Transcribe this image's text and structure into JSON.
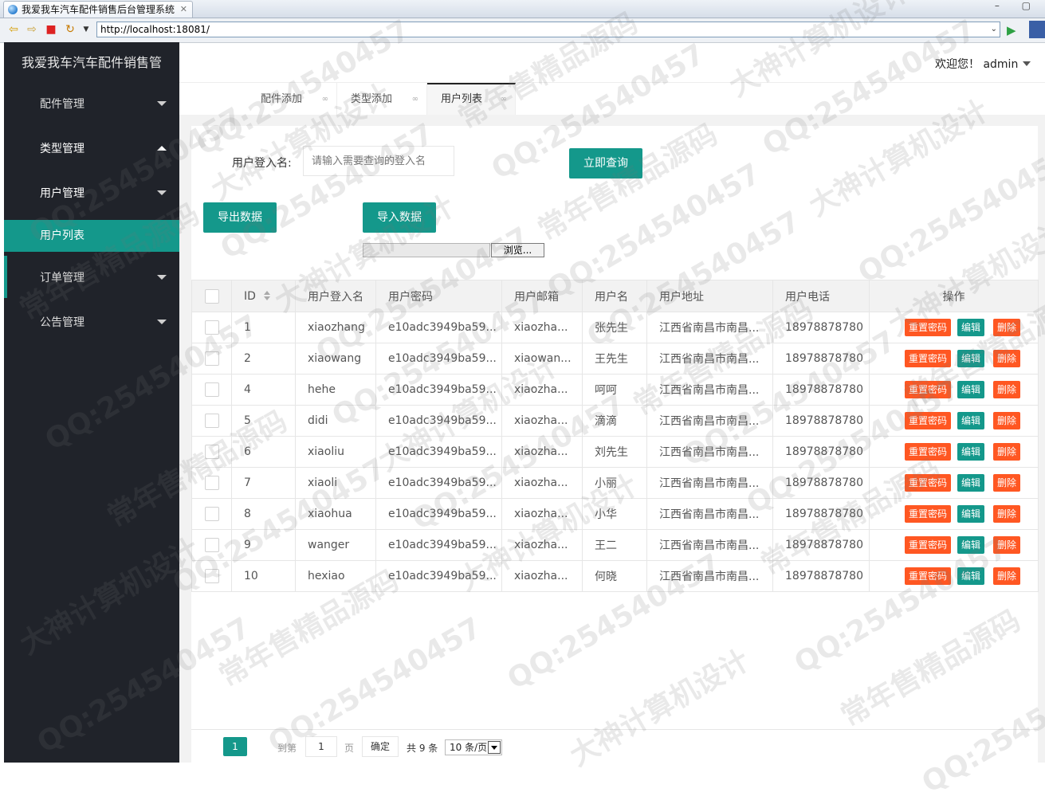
{
  "browser": {
    "tab_title": "我爱我车汽车配件销售后台管理系统",
    "url": "http://localhost:18081/"
  },
  "sidebar": {
    "brand": "我爱我车汽车配件销售管",
    "items": [
      {
        "label": "配件管理"
      },
      {
        "label": "类型管理"
      },
      {
        "label": "用户管理"
      },
      {
        "label": "用户列表"
      },
      {
        "label": "订单管理"
      },
      {
        "label": "公告管理"
      }
    ]
  },
  "header": {
    "welcome": "欢迎您！ admin"
  },
  "tabs": [
    {
      "label": "配件添加"
    },
    {
      "label": "类型添加"
    },
    {
      "label": "用户列表"
    }
  ],
  "search": {
    "label": "用户登入名:",
    "placeholder": "请输入需要查询的登入名",
    "query_button": "立即查询",
    "export_button": "导出数据",
    "import_button": "导入数据",
    "browse_button": "浏览..."
  },
  "table": {
    "headers": [
      "ID",
      "用户登入名",
      "用户密码",
      "用户邮箱",
      "用户名",
      "用户地址",
      "用户电话",
      "操作"
    ],
    "actions": {
      "reset": "重置密码",
      "edit": "编辑",
      "delete": "删除"
    },
    "rows": [
      {
        "id": "1",
        "login": "xiaozhang",
        "password": "e10adc3949ba59...",
        "email": "xiaozha...",
        "name": "张先生",
        "address": "江西省南昌市南昌...",
        "phone": "18978878780"
      },
      {
        "id": "2",
        "login": "xiaowang",
        "password": "e10adc3949ba59...",
        "email": "xiaowan...",
        "name": "王先生",
        "address": "江西省南昌市南昌...",
        "phone": "18978878780"
      },
      {
        "id": "4",
        "login": "hehe",
        "password": "e10adc3949ba59...",
        "email": "xiaozha...",
        "name": "呵呵",
        "address": "江西省南昌市南昌...",
        "phone": "18978878780"
      },
      {
        "id": "5",
        "login": "didi",
        "password": "e10adc3949ba59...",
        "email": "xiaozha...",
        "name": "滴滴",
        "address": "江西省南昌市南昌...",
        "phone": "18978878780"
      },
      {
        "id": "6",
        "login": "xiaoliu",
        "password": "e10adc3949ba59...",
        "email": "xiaozha...",
        "name": "刘先生",
        "address": "江西省南昌市南昌...",
        "phone": "18978878780"
      },
      {
        "id": "7",
        "login": "xiaoli",
        "password": "e10adc3949ba59...",
        "email": "xiaozha...",
        "name": "小丽",
        "address": "江西省南昌市南昌...",
        "phone": "18978878780"
      },
      {
        "id": "8",
        "login": "xiaohua",
        "password": "e10adc3949ba59...",
        "email": "xiaozha...",
        "name": "小华",
        "address": "江西省南昌市南昌...",
        "phone": "18978878780"
      },
      {
        "id": "9",
        "login": "wanger",
        "password": "e10adc3949ba59...",
        "email": "xiaozha...",
        "name": "王二",
        "address": "江西省南昌市南昌...",
        "phone": "18978878780"
      },
      {
        "id": "10",
        "login": "hexiao",
        "password": "e10adc3949ba59...",
        "email": "xiaozha...",
        "name": "何晓",
        "address": "江西省南昌市南昌...",
        "phone": "18978878780"
      }
    ]
  },
  "pager": {
    "current": "1",
    "goto_label": "到第",
    "page_value": "1",
    "page_unit": "页",
    "confirm": "确定",
    "total": "共 9 条",
    "page_size": "10 条/页"
  },
  "watermark": {
    "texts": [
      "QQ:25454045​7",
      "大神计算机设计",
      "常年售精品源码"
    ]
  },
  "colors": {
    "sidebar": "#20232a",
    "accent": "#14988b",
    "danger": "#ff5722"
  }
}
